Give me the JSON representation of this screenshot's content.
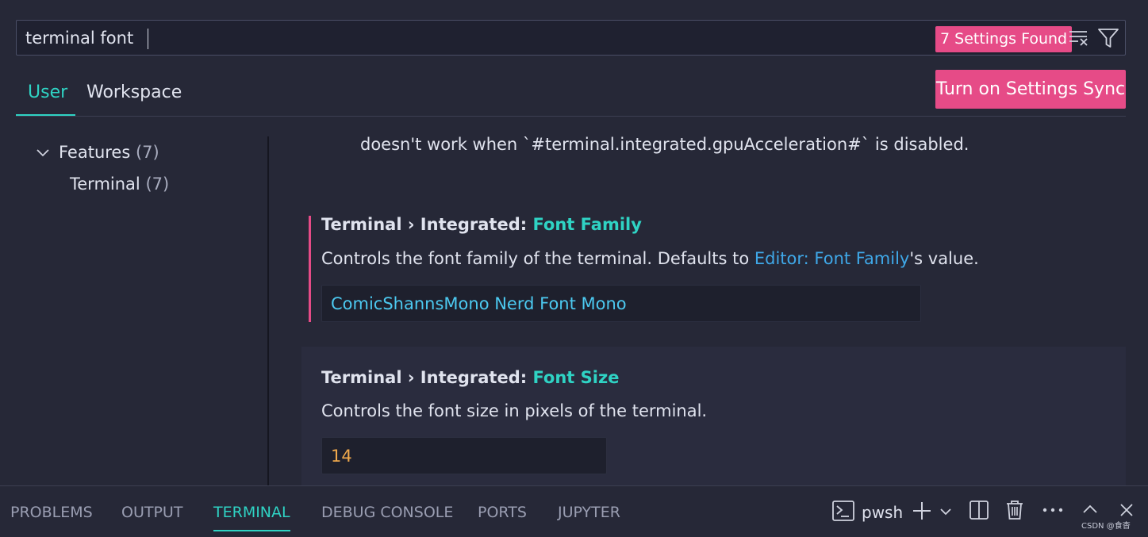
{
  "search": {
    "value": "terminal font",
    "results_badge": "7 Settings Found",
    "clear_icon": "clear-filter-icon",
    "filter_icon": "filter-icon"
  },
  "tabs": {
    "user": "User",
    "workspace": "Workspace",
    "active": "User"
  },
  "sync_button": "Turn on Settings Sync",
  "tree": {
    "features_label": "Features",
    "features_count": "(7)",
    "terminal_label": "Terminal",
    "terminal_count": "(7)"
  },
  "content": {
    "prev_desc_tail": "doesn't work when `#terminal.integrated.gpuAcceleration#` is disabled.",
    "settings": [
      {
        "prefix": "Terminal › Integrated: ",
        "name": "Font Family",
        "desc_before": "Controls the font family of the terminal. Defaults to ",
        "desc_link": "Editor: Font Family",
        "desc_after": "'s value.",
        "value": "ComicShannsMono Nerd Font Mono"
      },
      {
        "prefix": "Terminal › Integrated: ",
        "name": "Font Size",
        "desc": "Controls the font size in pixels of the terminal.",
        "value": "14"
      }
    ]
  },
  "panel": {
    "tabs": [
      "PROBLEMS",
      "OUTPUT",
      "TERMINAL",
      "DEBUG CONSOLE",
      "PORTS",
      "JUPYTER"
    ],
    "active_tab": "TERMINAL",
    "shell": "pwsh",
    "watermark": "CSDN @食杳"
  },
  "colors": {
    "accent_teal": "#2fd3c4",
    "accent_pink": "#e64b87",
    "link_blue": "#3fa8e8",
    "value_cyan": "#4cc9f0",
    "value_orange": "#f0a94c",
    "background": "#262837"
  }
}
